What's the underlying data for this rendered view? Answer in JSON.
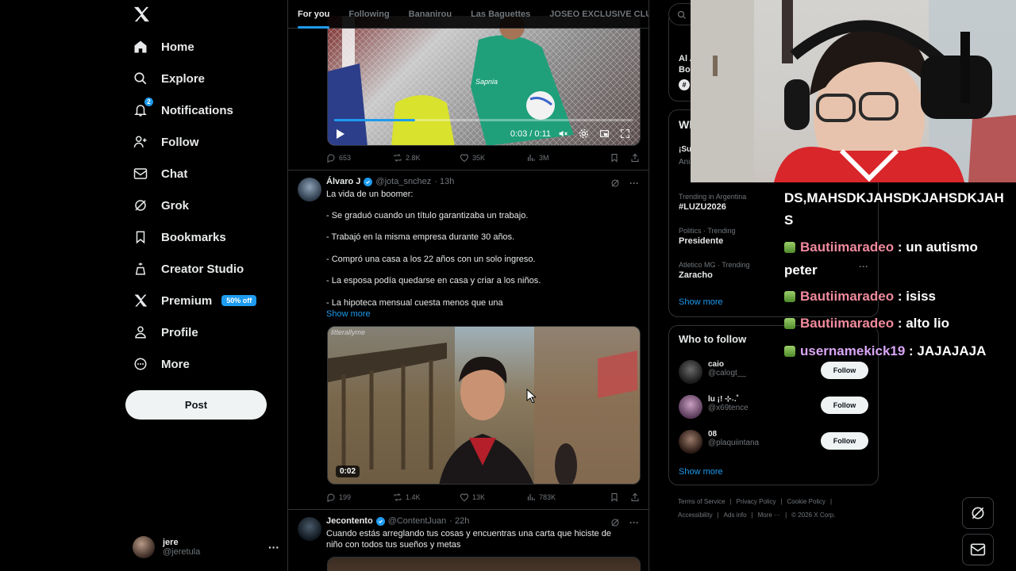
{
  "sidebar": {
    "nav": [
      {
        "label": "Home",
        "icon": "home-icon"
      },
      {
        "label": "Explore",
        "icon": "search-icon"
      },
      {
        "label": "Notifications",
        "icon": "bell-icon",
        "badge": "2"
      },
      {
        "label": "Follow",
        "icon": "person-add-icon"
      },
      {
        "label": "Chat",
        "icon": "mail-icon"
      },
      {
        "label": "Grok",
        "icon": "grok-icon"
      },
      {
        "label": "Bookmarks",
        "icon": "bookmark-icon"
      },
      {
        "label": "Creator Studio",
        "icon": "creator-icon"
      },
      {
        "label": "Premium",
        "icon": "x-icon",
        "pill": "50% off"
      },
      {
        "label": "Profile",
        "icon": "person-icon"
      },
      {
        "label": "More",
        "icon": "more-circle-icon"
      }
    ],
    "post_label": "Post",
    "account": {
      "name": "jere",
      "handle": "@jeretula",
      "menu": "···"
    }
  },
  "timeline": {
    "tabs": [
      "For you",
      "Following",
      "Bananirou",
      "Las Baguettes",
      "JOSEO EXCLUSIVE CLU"
    ],
    "video1": {
      "time": "0:03 / 0:11",
      "sponsor": "Sapnia",
      "actions": {
        "replies": "653",
        "reposts": "2.8K",
        "likes": "35K",
        "views": "3M"
      }
    },
    "tweet1": {
      "name": "Álvaro J",
      "handle": "@jota_snchez",
      "time": "· 13h",
      "lines": [
        "La vida de un boomer:",
        "- Se graduó cuando un título garantizaba un trabajo.",
        "- Trabajó en la misma empresa durante 30 años.",
        "- Compró una casa a los 22 años con un solo ingreso.",
        "- La esposa podía quedarse en casa y criar a los niños.",
        "- La hipoteca mensual cuesta menos que una"
      ],
      "show_more": "Show more",
      "watermark": "litterallyme",
      "video_time": "0:02",
      "actions": {
        "replies": "199",
        "reposts": "1.4K",
        "likes": "13K",
        "views": "783K"
      }
    },
    "tweet2": {
      "name": "Jecontento",
      "handle": "@ContentJuan",
      "time": "· 22h",
      "lines": [
        "Cuando estás arreglando tus cosas y encuentras  una carta que hiciste de",
        "niño con todos tus sueños y metas"
      ]
    }
  },
  "right": {
    "search_icon": "search-icon",
    "partial_top": [
      "Al A",
      "Boo"
    ],
    "wh_label": "Wh",
    "partial_items": [
      "¡Su",
      "Ani"
    ],
    "trends": [
      {
        "meta": "Trending in Argentina",
        "name": "#LUZU2026"
      },
      {
        "meta": "Politics · Trending",
        "name": "Presidente"
      },
      {
        "meta": "Atletico MG · Trending",
        "name": "Zaracho"
      }
    ],
    "trends_show_more": "Show more",
    "who_to_follow": {
      "title": "Who to follow",
      "users": [
        {
          "name": "caio",
          "handle": "@calogt__"
        },
        {
          "name": "lu ¡! ⊹˖.˚",
          "handle": "@x69tence"
        },
        {
          "name": "08",
          "handle": "@plaquiintana"
        }
      ],
      "follow_label": "Follow",
      "show_more": "Show more"
    },
    "footer": {
      "row1": [
        "Terms of Service",
        "|",
        "Privacy Policy",
        "|",
        "Cookie Policy",
        "|"
      ],
      "row2": [
        "Accessibility",
        "|",
        "Ads info",
        "|",
        "More ···",
        "|",
        "© 2026 X Corp."
      ]
    }
  },
  "chat": {
    "top_text_1": "DS,MAHSDKJAHSDKJAHSDKJAH",
    "top_text_2": "S",
    "messages": [
      {
        "user": "Bautiimaradeo",
        "text": " : un autismo",
        "cont": "peter",
        "color": "#f08a9c"
      },
      {
        "user": "Bautiimaradeo",
        "text": " : isiss",
        "color": "#f08a9c"
      },
      {
        "user": "Bautiimaradeo",
        "text": " : alto lio",
        "color": "#f08a9c"
      },
      {
        "user": "usernamekick19",
        "text": " : JAJAJAJA",
        "color": "#d9a6f5"
      }
    ]
  },
  "colors": {
    "accent": "#1d9bf0",
    "background": "#000000",
    "border": "#2f3336",
    "muted": "#71767b"
  }
}
